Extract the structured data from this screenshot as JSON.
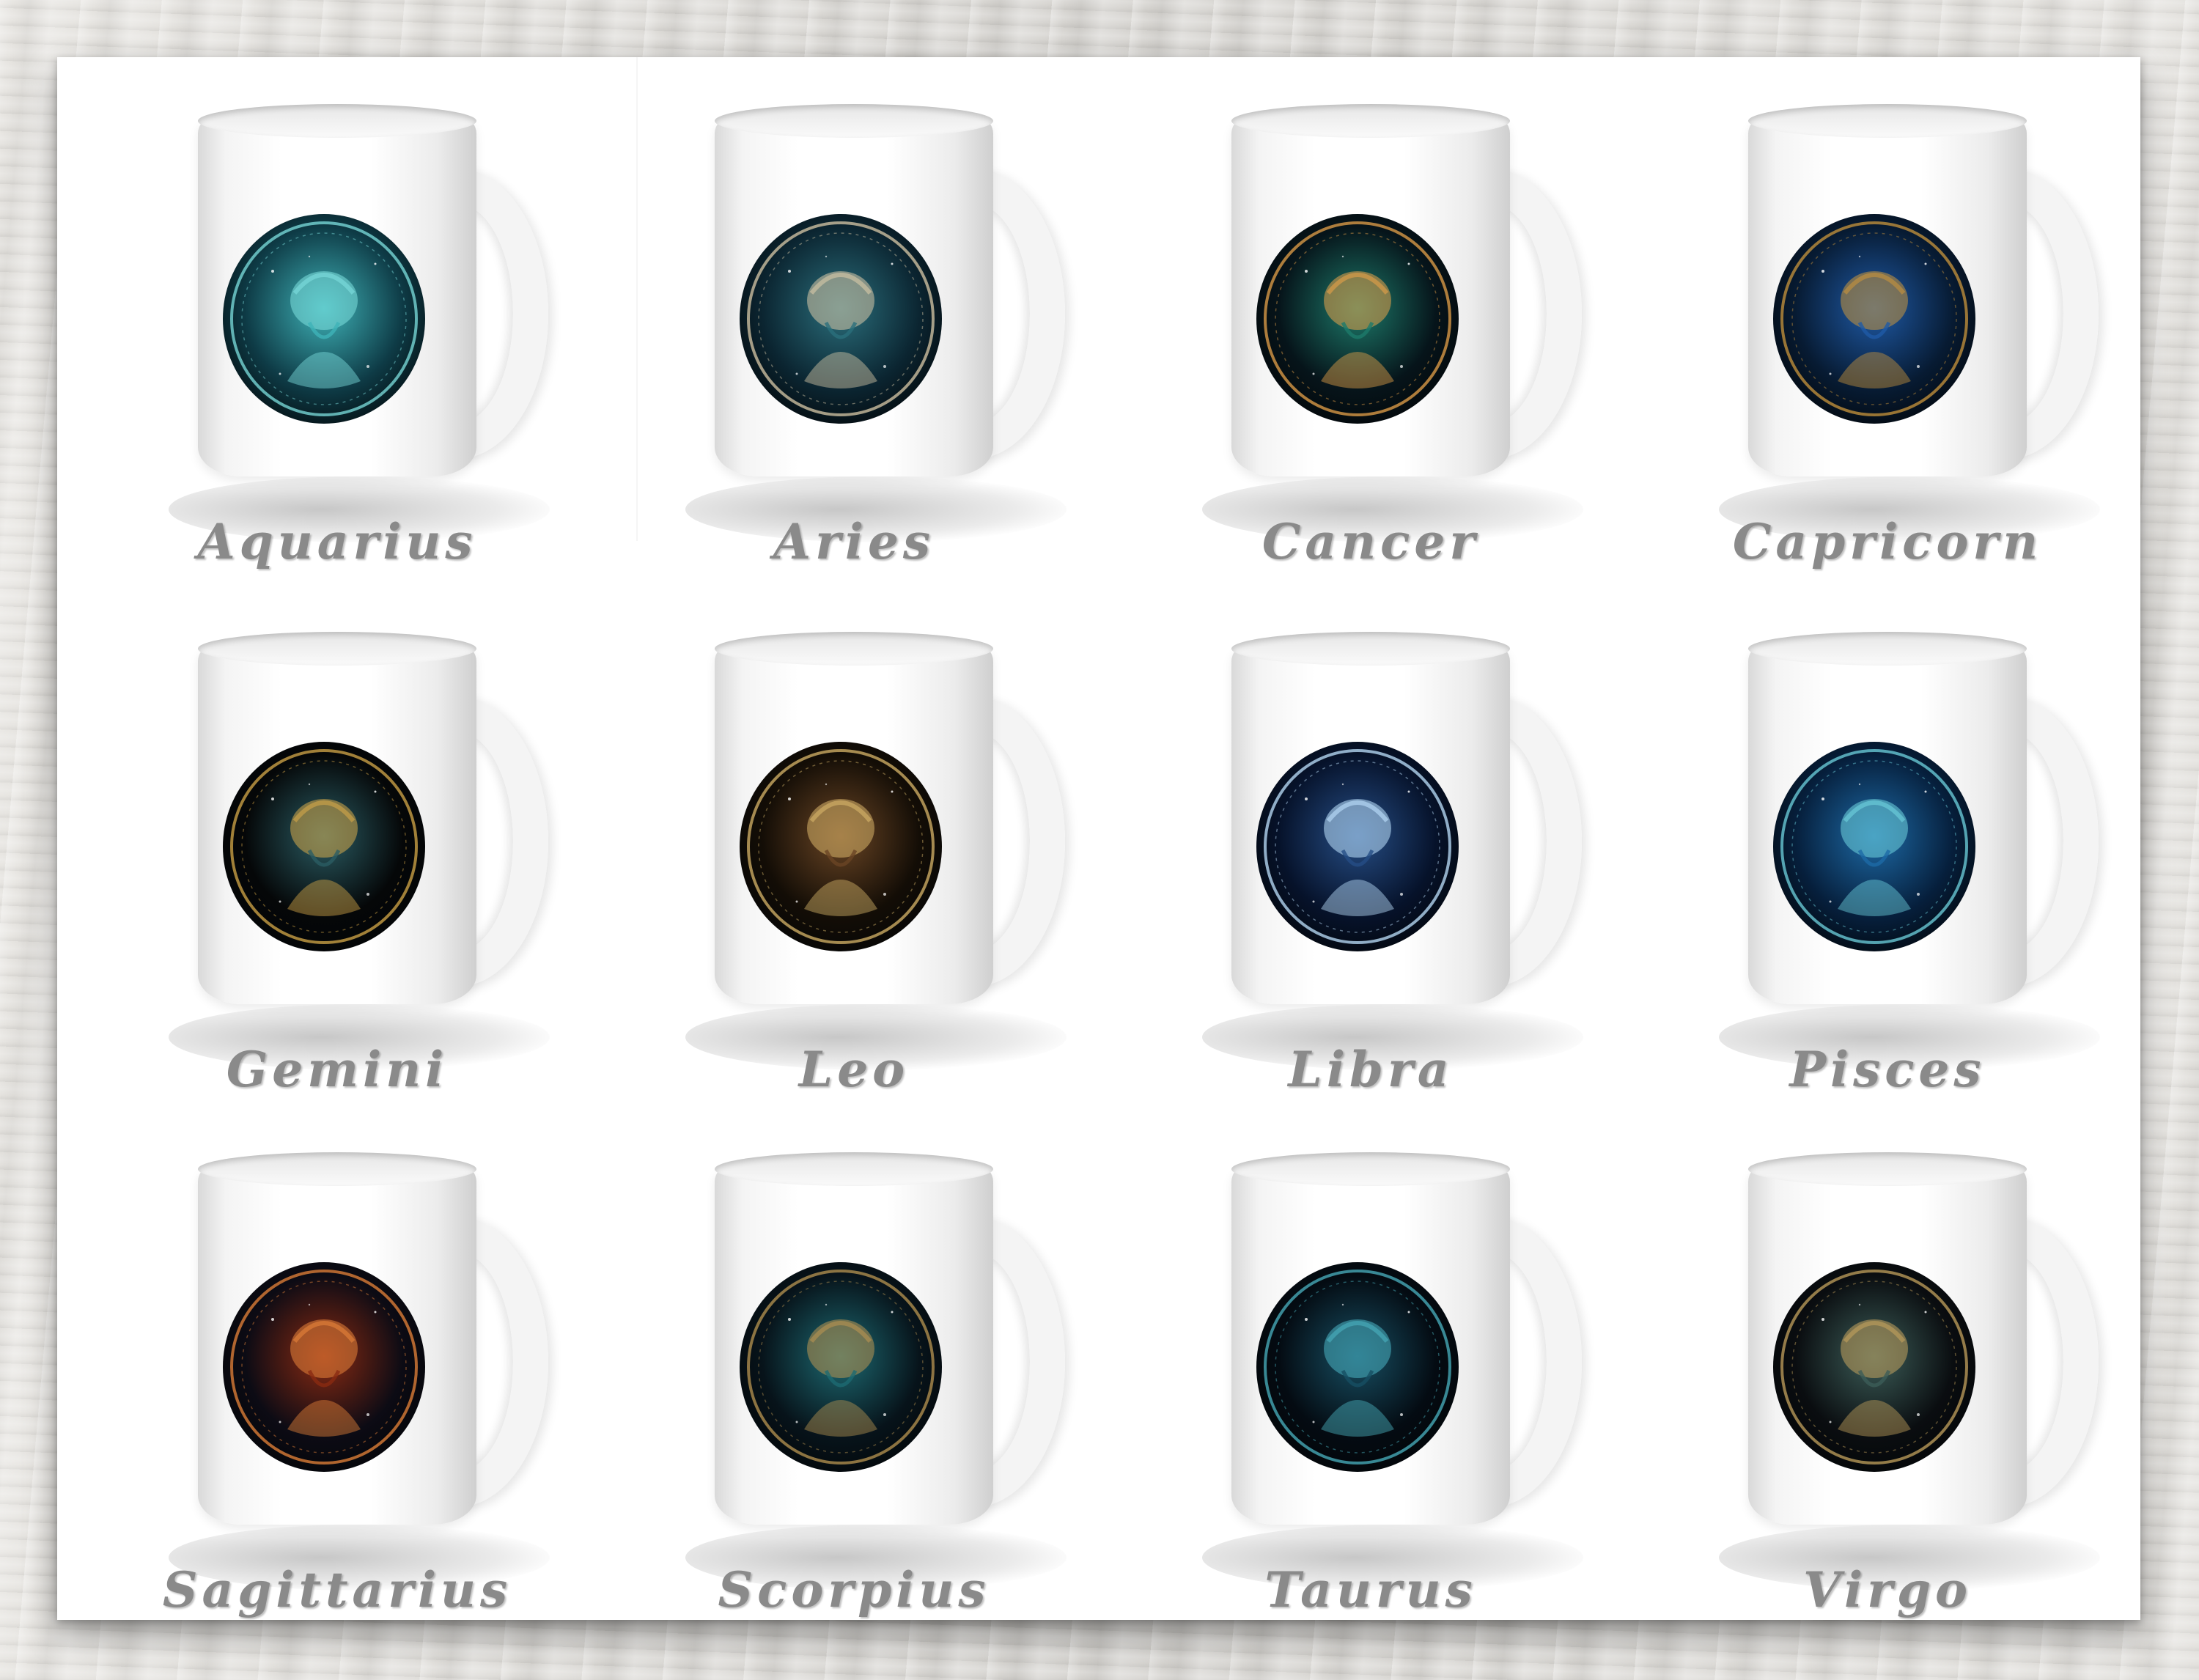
{
  "mugs": [
    {
      "label": "Aquarius",
      "art": "woman-water-icon",
      "colors": [
        "#0e3b46",
        "#3fb3b8",
        "#7ee0df"
      ]
    },
    {
      "label": "Aries",
      "art": "ram-icon",
      "colors": [
        "#0b2531",
        "#2b6f7c",
        "#d9c9a8"
      ]
    },
    {
      "label": "Cancer",
      "art": "crab-icon",
      "colors": [
        "#06141a",
        "#1d7a6a",
        "#e6a24a"
      ]
    },
    {
      "label": "Capricorn",
      "art": "goat-icon",
      "colors": [
        "#071b33",
        "#1f5aa6",
        "#c9953c"
      ]
    },
    {
      "label": "Gemini",
      "art": "twins-moon-icon",
      "colors": [
        "#050708",
        "#2a5c63",
        "#d6a94a"
      ]
    },
    {
      "label": "Leo",
      "art": "lion-icon",
      "colors": [
        "#130d06",
        "#6a4524",
        "#d8b56a"
      ]
    },
    {
      "label": "Libra",
      "art": "scales-icon",
      "colors": [
        "#06122a",
        "#264e86",
        "#bfe3ff"
      ]
    },
    {
      "label": "Pisces",
      "art": "fish-icon",
      "colors": [
        "#061f3c",
        "#1d6aa6",
        "#6fd3df"
      ]
    },
    {
      "label": "Sagittarius",
      "art": "archer-icon",
      "colors": [
        "#0c0b14",
        "#8a2a12",
        "#e8843a"
      ]
    },
    {
      "label": "Scorpius",
      "art": "scorpion-icon",
      "colors": [
        "#07131a",
        "#1d6a72",
        "#b99552"
      ]
    },
    {
      "label": "Taurus",
      "art": "bull-icon",
      "colors": [
        "#040b12",
        "#174f63",
        "#4bb3c2"
      ]
    },
    {
      "label": "Virgo",
      "art": "maiden-icon",
      "colors": [
        "#0a0d10",
        "#3c5d58",
        "#c3a25e"
      ]
    }
  ]
}
